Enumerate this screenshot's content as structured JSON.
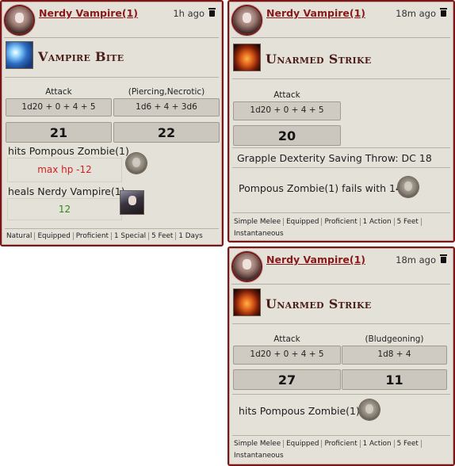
{
  "cards": [
    {
      "speaker": "Nerdy Vampire(1)",
      "time": "1h ago",
      "title": "Vampire Bite",
      "col1_label": "Attack",
      "col2_label": "(Piercing,Necrotic)",
      "col1_roll": "1d20 + 0 + 4 + 5",
      "col2_roll": "1d6 + 4 + 3d6",
      "col1_result": "21",
      "col2_result": "22",
      "hit_text": "hits Pompous Zombie(1)",
      "hit_effect": "max hp -12",
      "heal_text": "heals Nerdy Vampire(1)",
      "heal_value": "12",
      "tags": [
        "Natural",
        "Equipped",
        "Proficient",
        "1 Special",
        "5 Feet",
        "1 Days"
      ]
    },
    {
      "speaker": "Nerdy Vampire(1)",
      "time": "18m ago",
      "title": "Unarmed Strike",
      "col1_label": "Attack",
      "col1_roll": "1d20 + 0 + 4 + 5",
      "col1_result": "20",
      "save_text": "Grapple Dexterity Saving Throw: DC 18",
      "fail_text": "Pompous Zombie(1) fails with 14",
      "tags": [
        "Simple Melee",
        "Equipped",
        "Proficient",
        "1 Action",
        "5 Feet",
        "Instantaneous"
      ]
    },
    {
      "speaker": "Nerdy Vampire(1)",
      "time": "18m ago",
      "title": "Unarmed Strike",
      "col1_label": "Attack",
      "col2_label": "(Bludgeoning)",
      "col1_roll": "1d20 + 0 + 4 + 5",
      "col2_roll": "1d8 + 4",
      "col1_result": "27",
      "col2_result": "11",
      "hit_text": "hits Pompous Zombie(1)",
      "tags": [
        "Simple Melee",
        "Equipped",
        "Proficient",
        "1 Action",
        "5 Feet",
        "Instantaneous"
      ]
    }
  ],
  "colors": {
    "accent": "#8a1818",
    "damage": "#d02020",
    "heal": "#2a8a1a",
    "card_bg": "#e4e1d9"
  },
  "icons": {
    "delete": "trash-icon",
    "avatar": "vampire-avatar",
    "target": "zombie-token"
  }
}
